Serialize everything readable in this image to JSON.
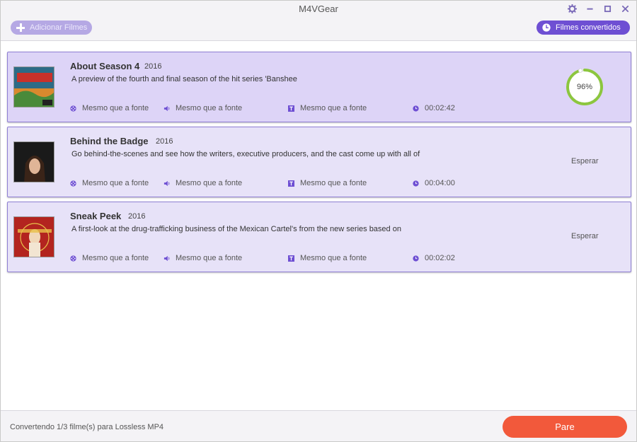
{
  "app": {
    "title": "M4VGear",
    "add_label": "Adicionar Filmes",
    "converted_label": "Filmes convertidos",
    "accent": "#6e4fd3"
  },
  "items": [
    {
      "title": "About Season 4",
      "year": "2016",
      "description": "A preview of the fourth and final season of the hit series 'Banshee",
      "video": "Mesmo que a fonte",
      "audio": "Mesmo que a fonte",
      "subtitle": "Mesmo que a fonte",
      "duration": "00:02:42",
      "progress_text": "96%",
      "progress": 0.96
    },
    {
      "title": "Behind the Badge",
      "year": "2016",
      "description": "Go behind-the-scenes and see how the writers, executive producers, and the cast come up with all of",
      "video": "Mesmo que a fonte",
      "audio": "Mesmo que a fonte",
      "subtitle": "Mesmo que a fonte",
      "duration": "00:04:00",
      "status": "Esperar"
    },
    {
      "title": "Sneak Peek",
      "year": "2016",
      "description": "A first-look at the drug-trafficking business of the Mexican Cartel's from the new series based on",
      "video": "Mesmo que a fonte",
      "audio": "Mesmo que a fonte",
      "subtitle": "Mesmo que a fonte",
      "duration": "00:02:02",
      "status": "Esperar"
    }
  ],
  "footer": {
    "status": "Convertendo 1/3 filme(s) para Lossless MP4",
    "stop_label": "Pare",
    "stop_color": "#f2593b"
  }
}
